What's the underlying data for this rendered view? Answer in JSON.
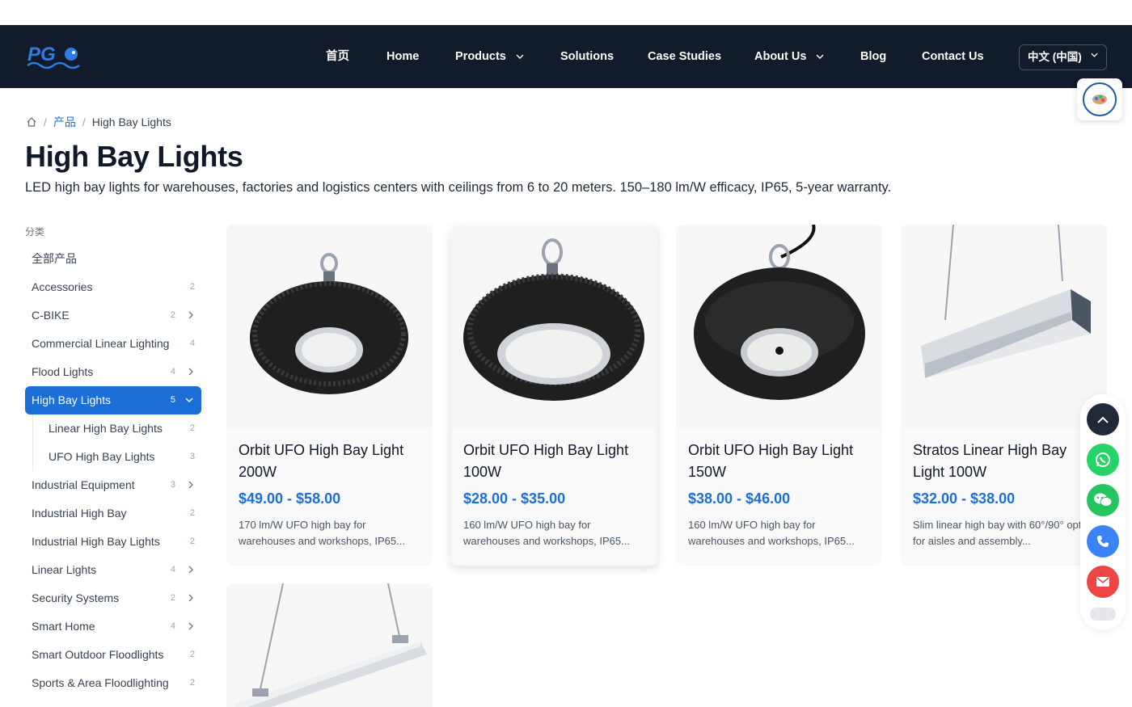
{
  "nav": {
    "items": [
      "首页",
      "Home",
      "Products",
      "Solutions",
      "Case Studies",
      "About Us",
      "Blog",
      "Contact Us"
    ],
    "language": "中文 (中国)"
  },
  "breadcrumb": {
    "parent": "产品",
    "current": "High Bay Lights"
  },
  "page": {
    "title": "High Bay Lights",
    "description": "LED high bay lights for warehouses, factories and logistics centers with ceilings from 6 to 20 meters. 150–180 lm/W efficacy, IP65, 5-year warranty."
  },
  "categories": {
    "heading": "分类",
    "items": [
      {
        "label": "全部产品",
        "count": ""
      },
      {
        "label": "Accessories",
        "count": "2"
      },
      {
        "label": "C-BIKE",
        "count": "2"
      },
      {
        "label": "Commercial Linear Lighting",
        "count": "4"
      },
      {
        "label": "Flood Lights",
        "count": "4"
      },
      {
        "label": "High Bay Lights",
        "count": "5"
      },
      {
        "label": "Linear High Bay Lights",
        "count": "2"
      },
      {
        "label": "UFO High Bay Lights",
        "count": "3"
      },
      {
        "label": "Industrial Equipment",
        "count": "3"
      },
      {
        "label": "Industrial High Bay",
        "count": "2"
      },
      {
        "label": "Industrial High Bay Lights",
        "count": "2"
      },
      {
        "label": "Linear Lights",
        "count": "4"
      },
      {
        "label": "Security Systems",
        "count": "2"
      },
      {
        "label": "Smart Home",
        "count": "4"
      },
      {
        "label": "Smart Outdoor Floodlights",
        "count": "2"
      },
      {
        "label": "Sports & Area Floodlighting",
        "count": "2"
      }
    ]
  },
  "products": [
    {
      "name": "Orbit UFO High Bay Light 200W",
      "price": "$49.00 - $58.00",
      "desc": "170 lm/W UFO high bay for warehouses and workshops, IP65..."
    },
    {
      "name": "Orbit UFO High Bay Light 100W",
      "price": "$28.00 - $35.00",
      "desc": "160 lm/W UFO high bay for warehouses and workshops, IP65..."
    },
    {
      "name": "Orbit UFO High Bay Light 150W",
      "price": "$38.00 - $46.00",
      "desc": "160 lm/W UFO high bay for warehouses and workshops, IP65..."
    },
    {
      "name": "Stratos Linear High Bay Light 100W",
      "price": "$32.00 - $38.00",
      "desc": "Slim linear high bay with 60°/90° optics for aisles and assembly..."
    }
  ],
  "colors": {
    "nav_bg": "#111b2c",
    "accent": "#1d6fd8",
    "whatsapp": "#25d366",
    "wechat": "#22c55e",
    "phone": "#3b82f6",
    "email": "#ef4444"
  },
  "logo_text": "PG"
}
